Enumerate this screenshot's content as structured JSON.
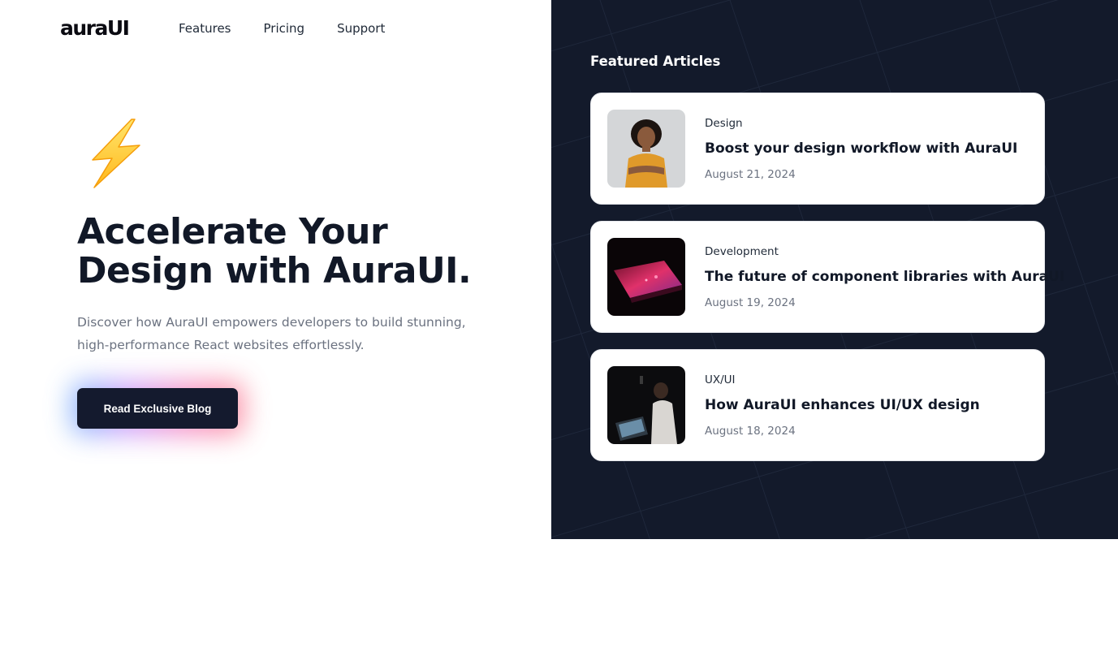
{
  "brand": {
    "logo_text": "auraUI"
  },
  "nav": {
    "items": [
      "Features",
      "Pricing",
      "Support"
    ]
  },
  "hero": {
    "icon": "lightning-bolt-icon",
    "title_line1": "Accelerate Your",
    "title_line2": "Design with AuraUI.",
    "subtitle": "Discover how AuraUI empowers developers to build stunning, high-performance React websites effortlessly.",
    "cta_label": "Read Exclusive Blog"
  },
  "featured": {
    "title": "Featured Articles",
    "articles": [
      {
        "category": "Design",
        "title": "Boost your design workflow with AuraUI",
        "date": "August 21, 2024",
        "image": "woman-portrait-image"
      },
      {
        "category": "Development",
        "title": "The future of component libraries with AuraUI",
        "date": "August 19, 2024",
        "image": "laptop-image"
      },
      {
        "category": "UX/UI",
        "title": "How AuraUI enhances UI/UX design",
        "date": "August 18, 2024",
        "image": "person-at-laptop-image"
      }
    ]
  },
  "colors": {
    "panel_bg": "#131a2b",
    "cta_bg": "#141a2e",
    "text_dark": "#111827",
    "text_muted": "#6b7280"
  }
}
